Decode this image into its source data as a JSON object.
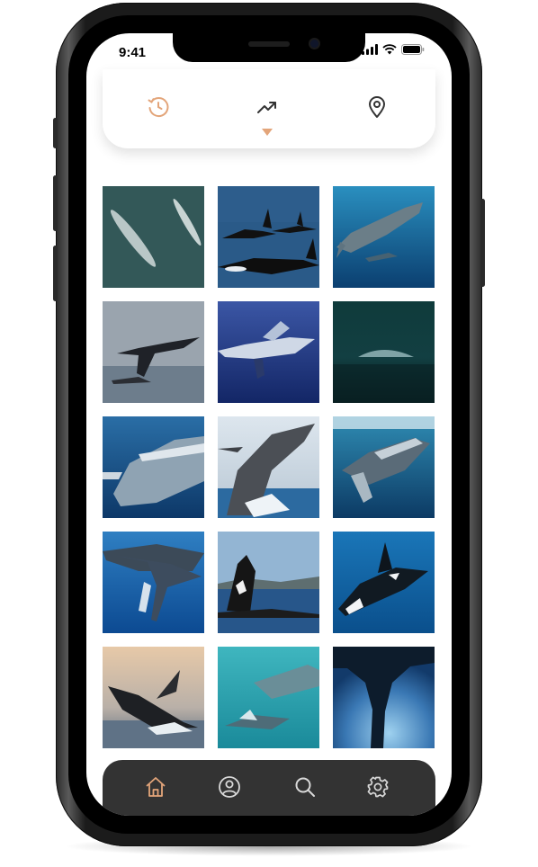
{
  "status_bar": {
    "time": "9:41"
  },
  "top_nav": {
    "items": [
      {
        "icon": "clock-icon",
        "active": false
      },
      {
        "icon": "trending-up-icon",
        "active": true
      },
      {
        "icon": "map-pin-icon",
        "active": false
      }
    ],
    "accent_color": "#E3A57A"
  },
  "gallery": {
    "items": [
      {
        "subject": "blue-whales-aerial"
      },
      {
        "subject": "orcas-surfacing"
      },
      {
        "subject": "whale-shark"
      },
      {
        "subject": "whale-tail-fluke"
      },
      {
        "subject": "humpback-underwater"
      },
      {
        "subject": "whale-back-dark-sea"
      },
      {
        "subject": "humpback-closeup"
      },
      {
        "subject": "humpback-breach"
      },
      {
        "subject": "humpback-diving"
      },
      {
        "subject": "humpbacks-with-calf"
      },
      {
        "subject": "orca-breach-coast"
      },
      {
        "subject": "orca-underwater"
      },
      {
        "subject": "humpback-breach-sunset"
      },
      {
        "subject": "whales-turquoise"
      },
      {
        "subject": "whale-tail-underwater"
      }
    ]
  },
  "bottom_nav": {
    "items": [
      {
        "icon": "home-icon",
        "active": true
      },
      {
        "icon": "profile-icon",
        "active": false
      },
      {
        "icon": "search-icon",
        "active": false
      },
      {
        "icon": "settings-icon",
        "active": false
      }
    ],
    "background": "#333333"
  }
}
